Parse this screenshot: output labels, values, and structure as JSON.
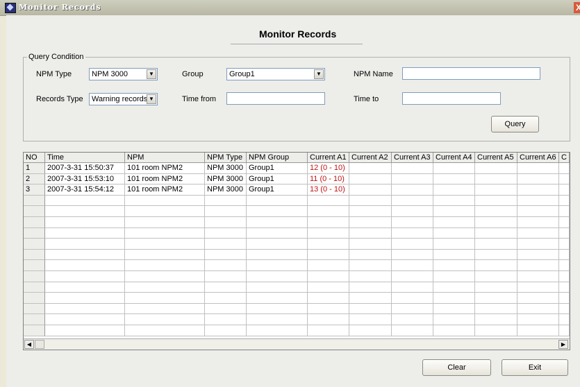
{
  "window": {
    "title": "Monitor Records",
    "icon": "app-icon",
    "close_icon": "close-icon",
    "close_glyph": "X"
  },
  "page": {
    "heading": "Monitor Records"
  },
  "query": {
    "legend": "Query Condition",
    "npm_type_label": "NPM Type",
    "npm_type_value": "NPM 3000",
    "group_label": "Group",
    "group_value": "Group1",
    "npm_name_label": "NPM Name",
    "npm_name_value": "",
    "records_type_label": "Records Type",
    "records_type_value": "Warning records",
    "time_from_label": "Time from",
    "time_from_value": "",
    "time_to_label": "Time to",
    "time_to_value": "",
    "query_button": "Query"
  },
  "table": {
    "columns": [
      "NO",
      "Time",
      "NPM",
      "NPM Type",
      "NPM Group",
      "Current A1",
      "Current A2",
      "Current A3",
      "Current A4",
      "Current A5",
      "Current A6",
      "C"
    ],
    "rows": [
      [
        "1",
        "2007-3-31 15:50:37",
        "101 room NPM2",
        "NPM 3000",
        "Group1",
        "12 (0 - 10)",
        "",
        "",
        "",
        "",
        "",
        ""
      ],
      [
        "2",
        "2007-3-31 15:53:10",
        "101 room NPM2",
        "NPM 3000",
        "Group1",
        "11 (0 - 10)",
        "",
        "",
        "",
        "",
        "",
        ""
      ],
      [
        "3",
        "2007-3-31 15:54:12",
        "101 room NPM2",
        "NPM 3000",
        "Group1",
        "13 (0 - 10)",
        "",
        "",
        "",
        "",
        "",
        ""
      ]
    ],
    "warning_color": "#c01010"
  },
  "footer": {
    "clear_button": "Clear",
    "exit_button": "Exit"
  }
}
